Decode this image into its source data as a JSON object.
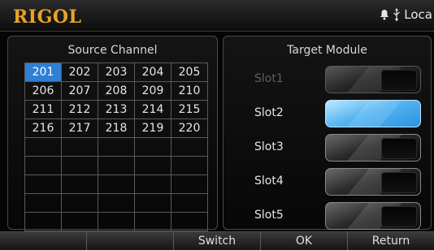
{
  "header": {
    "brand": "RIGOL",
    "status_text": "Loca",
    "icons": [
      "bell-icon",
      "usb-icon"
    ],
    "brand_color": "#e7a428"
  },
  "source": {
    "title": "Source Channel",
    "channels": [
      [
        "201",
        "202",
        "203",
        "204",
        "205"
      ],
      [
        "206",
        "207",
        "208",
        "209",
        "210"
      ],
      [
        "211",
        "212",
        "213",
        "214",
        "215"
      ],
      [
        "216",
        "217",
        "218",
        "219",
        "220"
      ]
    ],
    "selected": "201",
    "selected_color": "#2f7fd3"
  },
  "target": {
    "title": "Target Module",
    "slots": [
      {
        "label": "Slot1",
        "state": "disabled"
      },
      {
        "label": "Slot2",
        "state": "selected"
      },
      {
        "label": "Slot3",
        "state": "normal"
      },
      {
        "label": "Slot4",
        "state": "normal"
      },
      {
        "label": "Slot5",
        "state": "normal"
      }
    ],
    "selected_color": "#57b6f3"
  },
  "menu": {
    "items": [
      "",
      "",
      "Switch",
      "OK",
      "Return"
    ]
  }
}
